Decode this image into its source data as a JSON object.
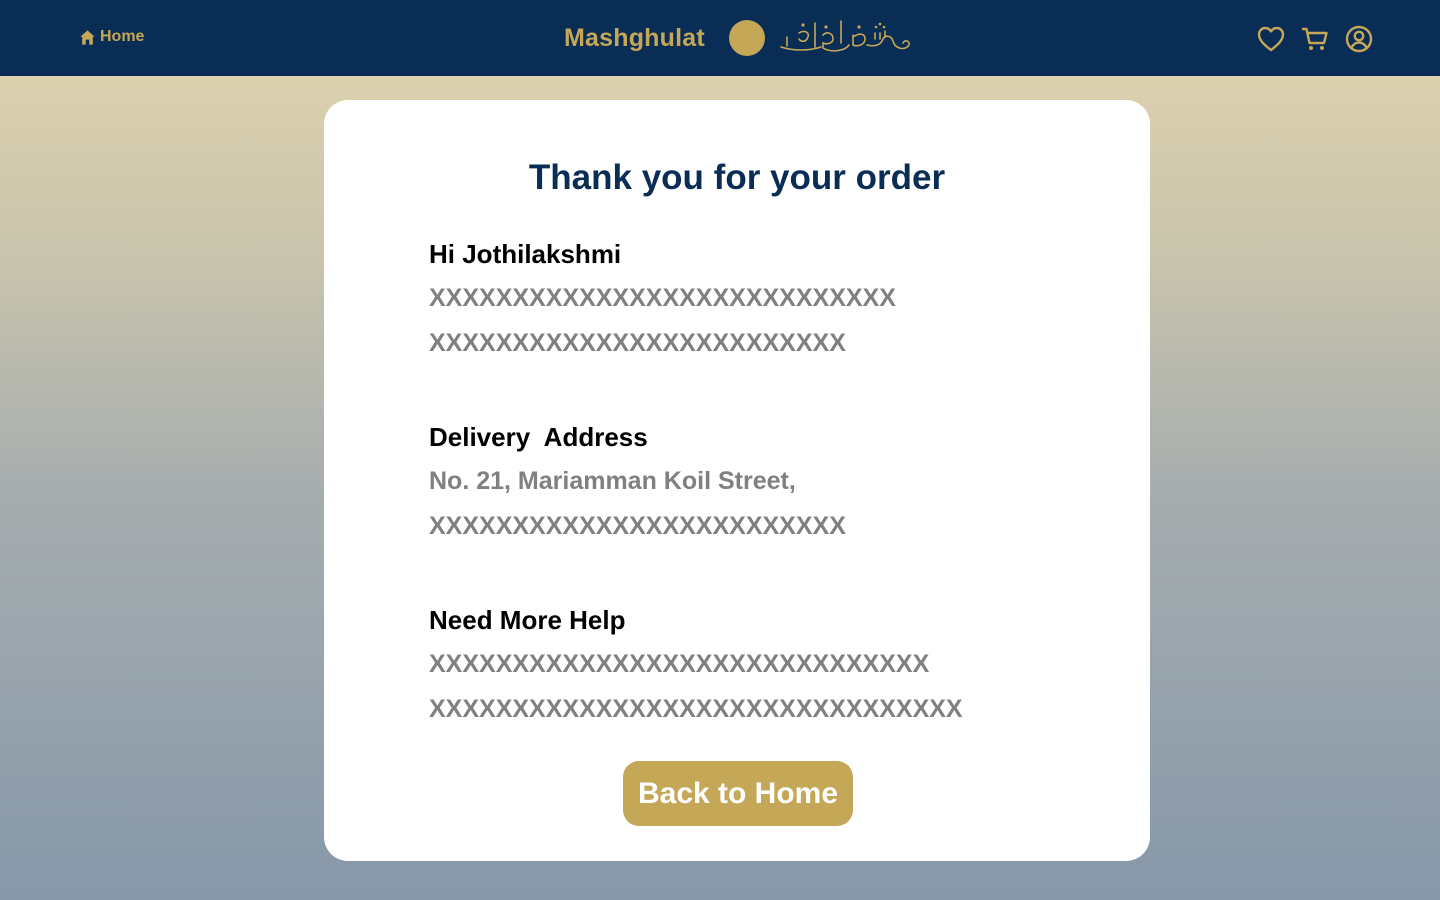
{
  "nav": {
    "home_label": "Home",
    "brand_name": "Mashghulat",
    "brand_arabic": "مشغولات",
    "icons": [
      "home-icon",
      "heart-icon",
      "cart-icon",
      "user-icon"
    ]
  },
  "colors": {
    "navy": "#0a2d55",
    "gold": "#c5a758",
    "muted_text": "#808080"
  },
  "confirmation": {
    "title": "Thank you for your order",
    "greeting": {
      "heading": "Hi Jothilakshmi",
      "lines": [
        "XXXXXXXXXXXXXXXXXXXXXXXXXXXX",
        "XXXXXXXXXXXXXXXXXXXXXXXXX"
      ]
    },
    "address": {
      "heading": "Delivery  Address",
      "lines": [
        "No. 21, Mariamman Koil Street,",
        "XXXXXXXXXXXXXXXXXXXXXXXXX"
      ]
    },
    "help": {
      "heading": "Need More Help",
      "lines": [
        "XXXXXXXXXXXXXXXXXXXXXXXXXXXXXX",
        "XXXXXXXXXXXXXXXXXXXXXXXXXXXXXXXX"
      ]
    },
    "back_button": "Back to Home"
  }
}
